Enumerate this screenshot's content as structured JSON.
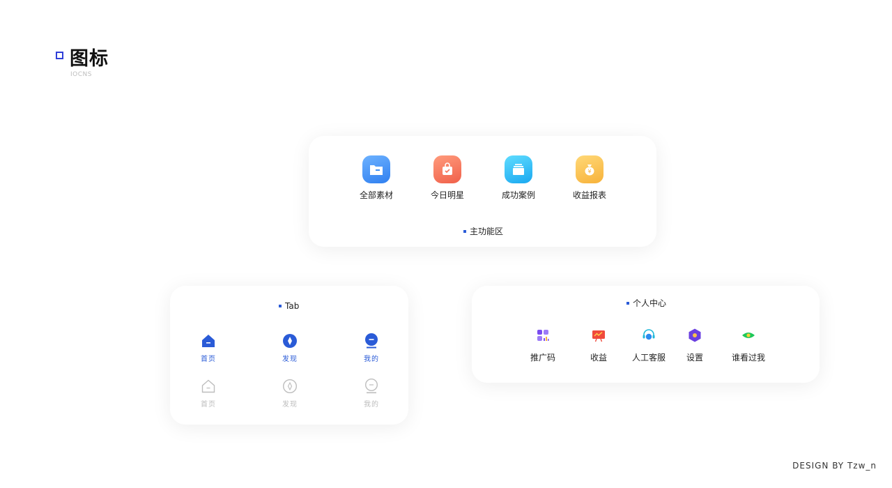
{
  "page": {
    "title": "图标",
    "subtitle": "IOCNS",
    "accent": "#2f3fd8",
    "credit": "DESIGN BY Tzw_n"
  },
  "main_area": {
    "label": "主功能区",
    "items": [
      {
        "label": "全部素材",
        "icon": "folder-icon",
        "color": "#3a8ef6"
      },
      {
        "label": "今日明星",
        "icon": "bag-icon",
        "color": "#f4735a"
      },
      {
        "label": "成功案例",
        "icon": "stack-icon",
        "color": "#2bb8f5"
      },
      {
        "label": "收益报表",
        "icon": "money-bag-icon",
        "color": "#f9c04a"
      }
    ]
  },
  "tab_bar": {
    "label": "Tab",
    "active_color": "#2a5bd7",
    "inactive_color": "#bdbdbd",
    "active": [
      {
        "label": "首页",
        "icon": "home-icon"
      },
      {
        "label": "发现",
        "icon": "compass-icon"
      },
      {
        "label": "我的",
        "icon": "profile-icon"
      }
    ],
    "inactive": [
      {
        "label": "首页",
        "icon": "home-icon"
      },
      {
        "label": "发现",
        "icon": "compass-icon"
      },
      {
        "label": "我的",
        "icon": "profile-icon"
      }
    ]
  },
  "personal_center": {
    "label": "个人中心",
    "items": [
      {
        "label": "推广码",
        "icon": "qr-grid-icon",
        "color": "#7a4cf0"
      },
      {
        "label": "收益",
        "icon": "chart-board-icon",
        "color": "#f04a3c"
      },
      {
        "label": "人工客服",
        "icon": "headset-icon",
        "color": "#1fb8d8"
      },
      {
        "label": "设置",
        "icon": "hexagon-settings-icon",
        "color": "#6a3fe0"
      },
      {
        "label": "谁看过我",
        "icon": "eye-icon",
        "color": "#1ec85a"
      }
    ]
  }
}
